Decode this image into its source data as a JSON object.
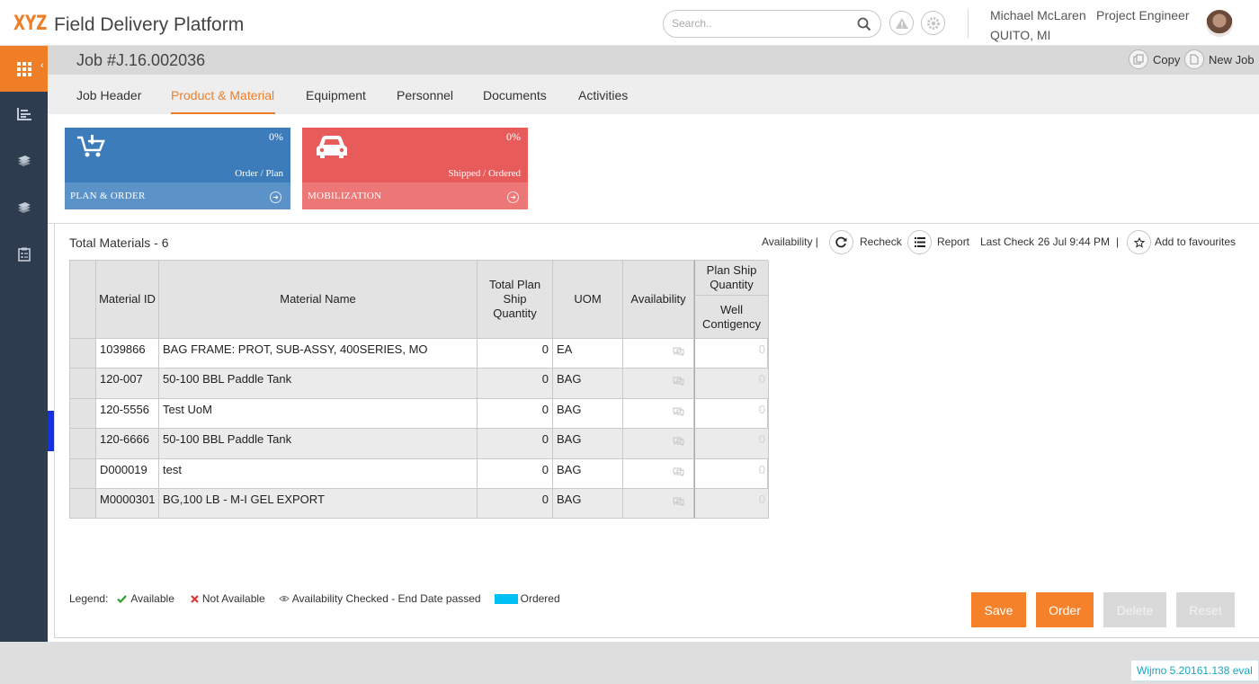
{
  "brand": {
    "logo": "XYZ",
    "title": "Field Delivery Platform",
    "accent": "#f07e26",
    "sidebar_color": "#2e3c4f"
  },
  "search": {
    "placeholder": "Search.."
  },
  "user": {
    "name": "Michael McLaren",
    "role": "Project Engineer",
    "location": "QUITO, MI"
  },
  "job": {
    "title": "Job #J.16.002036",
    "copy_label": "Copy",
    "new_job_label": "New Job"
  },
  "tabs": [
    {
      "label": "Job Header"
    },
    {
      "label": "Product & Material",
      "active": true
    },
    {
      "label": "Equipment"
    },
    {
      "label": "Personnel"
    },
    {
      "label": "Documents"
    },
    {
      "label": "Activities"
    }
  ],
  "tiles": [
    {
      "percent": "0%",
      "subtitle": "Order / Plan",
      "label": "PLAN & ORDER",
      "color": "#3c7cbb",
      "icon": "cart-download-icon"
    },
    {
      "percent": "0%",
      "subtitle": "Shipped / Ordered",
      "label": "MOBILIZATION",
      "color": "#e85b5b",
      "icon": "car-icon"
    }
  ],
  "materials": {
    "title": "Total Materials - 6",
    "availability_label": "Availability |",
    "recheck_label": "Recheck",
    "report_label": "Report",
    "last_check_label": "Last Check",
    "last_check_value": "26 Jul 9:44 PM",
    "separator": "|",
    "favourites_label": "Add to favourites",
    "columns": {
      "material_id": "Material ID",
      "material_name": "Material Name",
      "total_plan": "Total Plan Ship Quantity",
      "uom": "UOM",
      "availability": "Availability",
      "plan_ship_group": "Plan Ship Quantity",
      "well_contingency": "Well Contigency"
    },
    "rows": [
      {
        "id": "1039866",
        "name": "BAG FRAME: PROT, SUB-ASSY, 400SERIES, MO",
        "qty": "0",
        "uom": "EA",
        "well": "0"
      },
      {
        "id": "120-007",
        "name": "50-100 BBL Paddle Tank",
        "qty": "0",
        "uom": "BAG",
        "well": "0"
      },
      {
        "id": "120-5556",
        "name": "Test UoM",
        "qty": "0",
        "uom": "BAG",
        "well": "0"
      },
      {
        "id": "120-6666",
        "name": "50-100 BBL Paddle Tank",
        "qty": "0",
        "uom": "BAG",
        "well": "0"
      },
      {
        "id": "D000019",
        "name": "test",
        "qty": "0",
        "uom": "BAG",
        "well": "0"
      },
      {
        "id": "M0000301",
        "name": "BG,100 LB - M-I GEL EXPORT",
        "qty": "0",
        "uom": "BAG",
        "well": "0"
      }
    ]
  },
  "legend": {
    "label": "Legend:",
    "available": "Available",
    "not_available": "Not Available",
    "checked": "Availability Checked - End Date passed",
    "ordered": "Ordered",
    "ordered_color": "#00bff3"
  },
  "actions": {
    "save": "Save",
    "order": "Order",
    "delete": "Delete",
    "reset": "Reset"
  },
  "footer": {
    "watermark": "Wijmo 5.20161.138 eval"
  }
}
